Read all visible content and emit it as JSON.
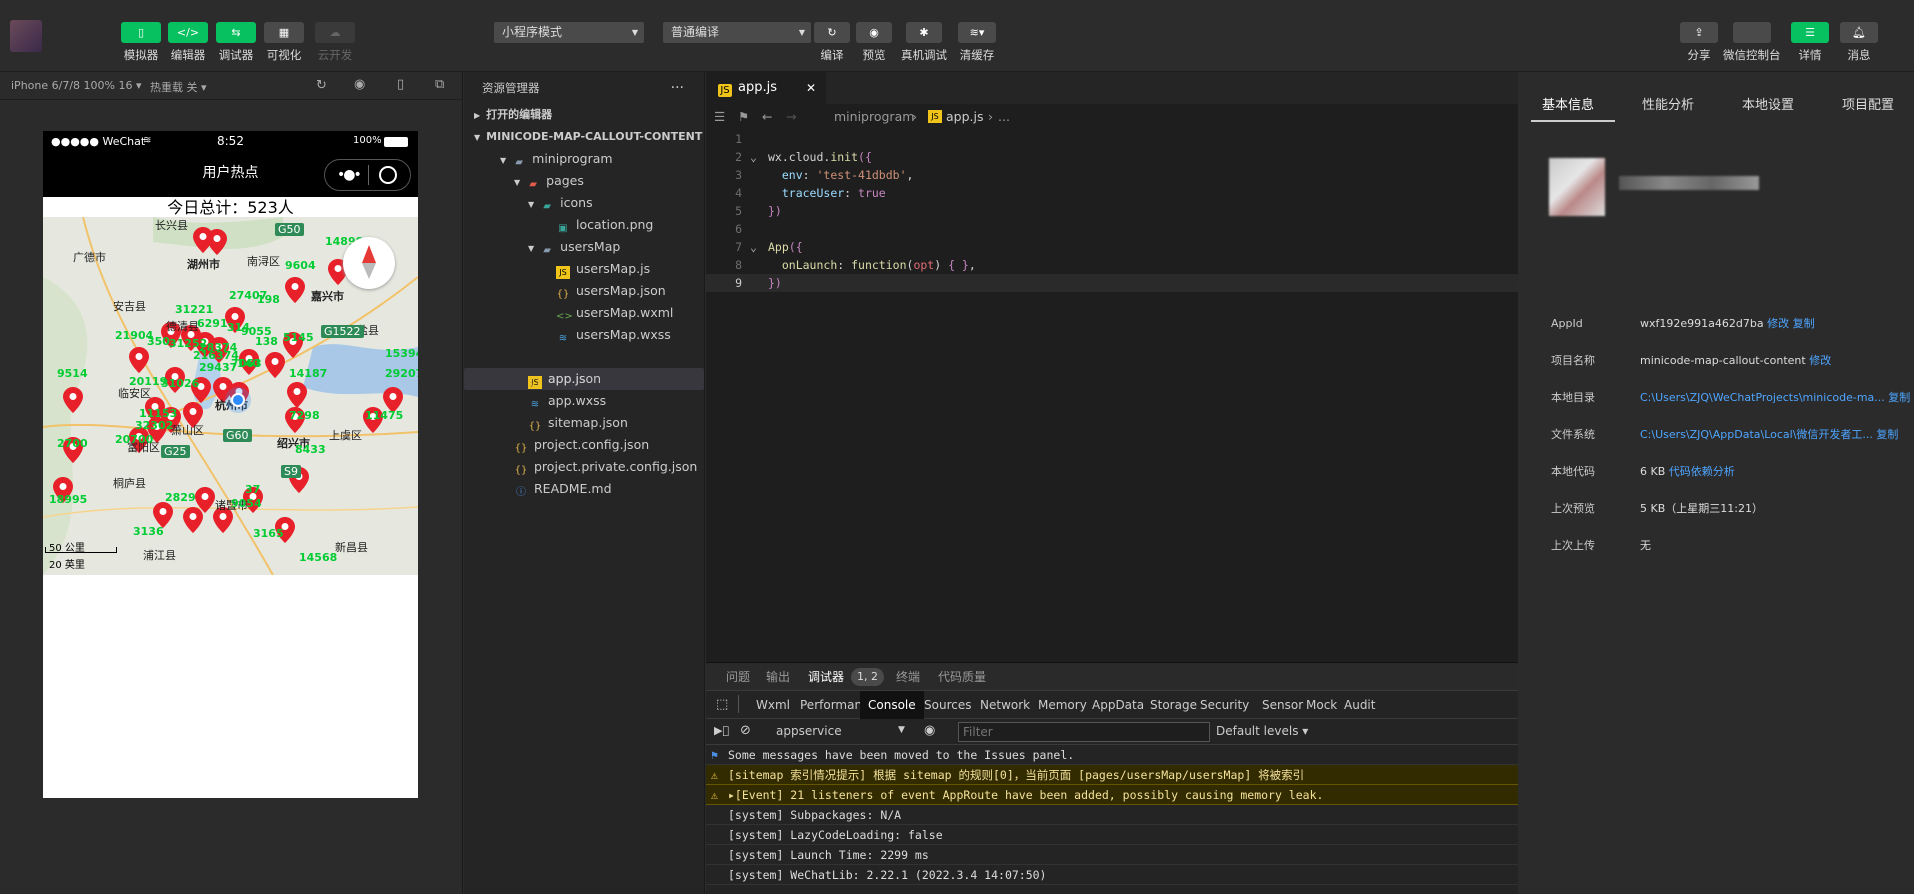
{
  "toolbar": {
    "simulator": "模拟器",
    "editor": "编辑器",
    "debugger": "调试器",
    "visual": "可视化",
    "cloud": "云开发",
    "mode_select": "小程序模式",
    "compile_select": "普通编译",
    "compile": "编译",
    "preview": "预览",
    "real_debug": "真机调试",
    "clear_cache": "清缓存",
    "share": "分享",
    "wxcloud": "微信控制台",
    "details": "详情",
    "messages": "消息"
  },
  "simulator": {
    "device": "iPhone 6/7/8 100% 16 ▾",
    "hot_reload": "热重载 关 ▾",
    "status_carrier": "●●●●● WeChat",
    "status_time": "8:52",
    "status_battery": "100%",
    "nav_title": "用户热点",
    "total_text": "今日总计：523人",
    "scale_m": "50 公里",
    "scale_mi": "20 英里",
    "map_labels": [
      "长兴县",
      "湖州市",
      "广德市",
      "南浔区",
      "嘉兴市",
      "安吉县",
      "德清县",
      "海盐县",
      "杭州市",
      "临安区",
      "富阳区",
      "萧山区",
      "绍兴市",
      "上虞区",
      "桐庐县",
      "诸暨市",
      "浦江县",
      "新昌县"
    ],
    "map_numbers": [
      "14898",
      "9604",
      "27407",
      "198",
      "31221",
      "21904",
      "6291",
      "314",
      "9055",
      "138",
      "5145",
      "350",
      "31252",
      "28374",
      "216374",
      "29437",
      "7063",
      "140",
      "14187",
      "15394",
      "29207",
      "9514",
      "20119",
      "31026",
      "11153",
      "32302",
      "20700",
      "7298",
      "11475",
      "2700",
      "8433",
      "18995",
      "2829",
      "37",
      "9054",
      "3136",
      "3165",
      "14568"
    ],
    "road_labels": [
      "G50",
      "G1522",
      "G60",
      "S9",
      "G25"
    ]
  },
  "explorer": {
    "title": "资源管理器",
    "more": "···",
    "open_editors": "打开的编辑器",
    "project": "MINICODE-MAP-CALLOUT-CONTENT",
    "items": [
      {
        "label": "miniprogram",
        "type": "folder"
      },
      {
        "label": "pages",
        "type": "folder-red"
      },
      {
        "label": "icons",
        "type": "folder-teal"
      },
      {
        "label": "location.png",
        "type": "image"
      },
      {
        "label": "usersMap",
        "type": "folder"
      },
      {
        "label": "usersMap.js",
        "type": "js"
      },
      {
        "label": "usersMap.json",
        "type": "json"
      },
      {
        "label": "usersMap.wxml",
        "type": "wxml"
      },
      {
        "label": "usersMap.wxss",
        "type": "wxss"
      },
      {
        "label": "app.js",
        "type": "js"
      },
      {
        "label": "app.json",
        "type": "json"
      },
      {
        "label": "app.wxss",
        "type": "wxss"
      },
      {
        "label": "sitemap.json",
        "type": "json"
      },
      {
        "label": "project.config.json",
        "type": "json"
      },
      {
        "label": "project.private.config.json",
        "type": "json"
      },
      {
        "label": "README.md",
        "type": "info"
      }
    ]
  },
  "editor": {
    "tab_label": "app.js",
    "tab_close": "✕",
    "breadcrumb": [
      "miniprogram",
      "app.js",
      "..."
    ]
  },
  "devtools": {
    "top_tabs": [
      "问题",
      "输出",
      "调试器",
      "终端",
      "代码质量"
    ],
    "badge": "1, 2",
    "panel_tabs": [
      "Wxml",
      "Performance",
      "Console",
      "Sources",
      "Network",
      "Memory",
      "AppData",
      "Storage",
      "Security",
      "Sensor",
      "Mock",
      "Audit"
    ],
    "context": "appservice",
    "filter_placeholder": "Filter",
    "levels": "Default levels ▾",
    "messages": [
      {
        "text": "Some messages have been moved to the Issues panel.",
        "kind": "info"
      },
      {
        "text": "[sitemap 索引情况提示] 根据 sitemap 的规则[0]，当前页面 [pages/usersMap/usersMap] 将被索引",
        "kind": "warn"
      },
      {
        "text": "▸[Event] 21 listeners of event AppRoute have been added, possibly causing memory leak.",
        "kind": "warn"
      },
      {
        "text": "[system] Subpackages: N/A",
        "kind": "log"
      },
      {
        "text": "[system] LazyCodeLoading: false",
        "kind": "log"
      },
      {
        "text": "[system] Launch Time: 2299 ms",
        "kind": "log"
      },
      {
        "text": "[system] WeChatLib: 2.22.1 (2022.3.4 14:07:50)",
        "kind": "log"
      }
    ]
  },
  "info": {
    "tabs": [
      "基本信息",
      "性能分析",
      "本地设置",
      "项目配置"
    ],
    "rows": [
      {
        "label": "AppId",
        "value": "wxf192e991a462d7ba",
        "links": [
          "修改",
          "复制"
        ]
      },
      {
        "label": "项目名称",
        "value": "minicode-map-callout-content",
        "links": [
          "修改"
        ]
      },
      {
        "label": "本地目录",
        "value": "C:\\Users\\ZJQ\\WeChatProjects\\minicode-ma...",
        "links": [
          "复制"
        ]
      },
      {
        "label": "文件系统",
        "value": "C:\\Users\\ZJQ\\AppData\\Local\\微信开发者工...",
        "links": [
          "复制"
        ]
      },
      {
        "label": "本地代码",
        "value": "6 KB",
        "links": [
          "代码依赖分析"
        ]
      },
      {
        "label": "上次预览",
        "value": "5 KB（上星期三11:21）",
        "links": []
      },
      {
        "label": "上次上传",
        "value": "无",
        "links": []
      }
    ]
  },
  "colors": {
    "accent": "#07c160",
    "link": "#4ea5ff",
    "warn_bg": "#332b00"
  }
}
